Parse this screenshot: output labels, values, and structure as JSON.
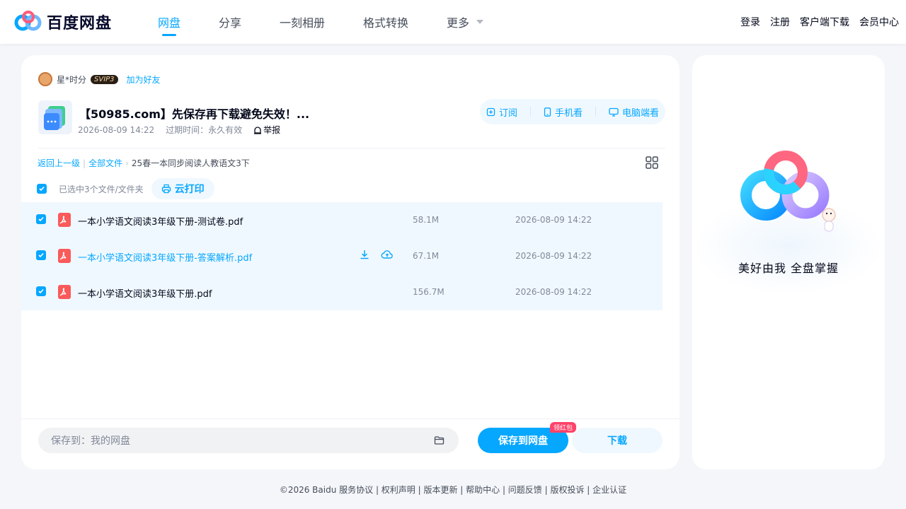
{
  "header": {
    "logo_text": "百度网盘",
    "nav": [
      {
        "label": "网盘"
      },
      {
        "label": "分享"
      },
      {
        "label": "一刻相册"
      },
      {
        "label": "格式转换"
      },
      {
        "label": "更多"
      }
    ],
    "right_links": [
      "登录",
      "注册",
      "客户端下载",
      "会员中心"
    ]
  },
  "share": {
    "sharer_name": "星*时分",
    "vip_badge": "SVIP3",
    "add_friend": "加为好友",
    "title": "【50985.com】先保存再下载避免失效！...",
    "date": "2026-08-09 14:22",
    "expire_label": "过期时间：",
    "expire_value": "永久有效",
    "report": "举报",
    "actions": {
      "subscribe": "订阅",
      "mobile": "手机看",
      "desktop": "电脑端看"
    }
  },
  "breadcrumb": {
    "back": "返回上一级",
    "all_files": "全部文件",
    "current": "25春一本同步阅读人教语文3下"
  },
  "selection": {
    "text": "已选中3个文件/文件夹",
    "print": "云打印"
  },
  "files": [
    {
      "name": "一本小学语文阅读3年级下册-测试卷.pdf",
      "size": "58.1M",
      "date": "2026-08-09 14:22"
    },
    {
      "name": "一本小学语文阅读3年级下册-答案解析.pdf",
      "size": "67.1M",
      "date": "2026-08-09 14:22"
    },
    {
      "name": "一本小学语文阅读3年级下册.pdf",
      "size": "156.7M",
      "date": "2026-08-09 14:22"
    }
  ],
  "bottom": {
    "save_path": "保存到：我的网盘",
    "save_button": "保存到网盘",
    "badge": "领红包",
    "download_button": "下载"
  },
  "promo": {
    "slogan": "美好由我  全盘掌握"
  },
  "footer": {
    "text": "©2026 Baidu  服务协议 | 权利声明 | 版本更新 | 帮助中心 | 问题反馈 | 版权投诉 | 企业认证"
  },
  "colors": {
    "accent": "#06a7ff",
    "pdf": "#fa5a5a",
    "badge": "#ff436a"
  }
}
